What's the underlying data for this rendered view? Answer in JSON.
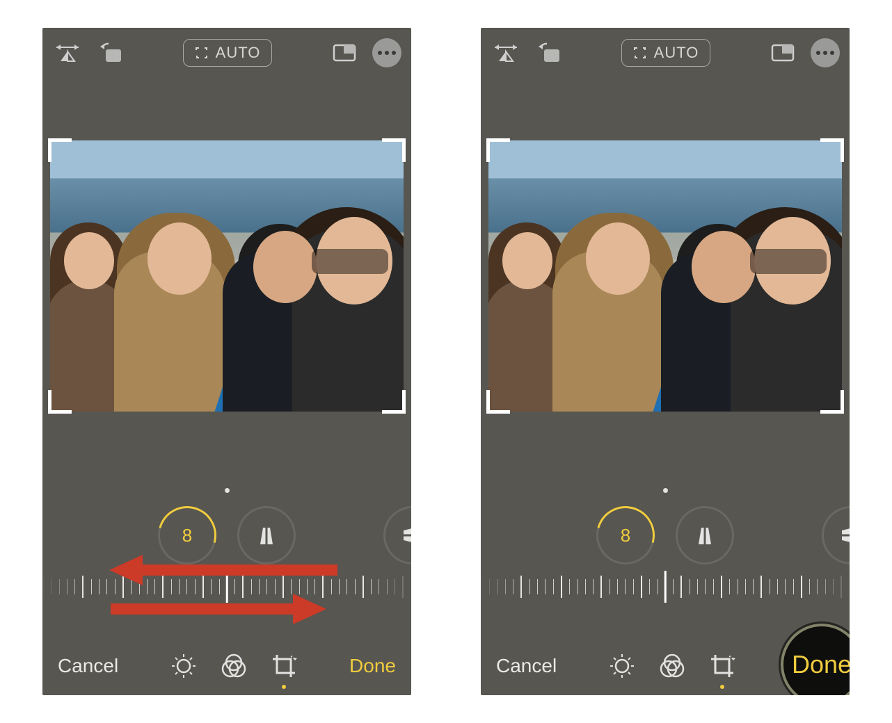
{
  "topbar": {
    "auto_label": "AUTO"
  },
  "adjust": {
    "straighten_value": "8"
  },
  "bottombar": {
    "cancel_label": "Cancel",
    "done_label": "Done"
  },
  "annotation": {
    "done_highlight": "Done"
  }
}
